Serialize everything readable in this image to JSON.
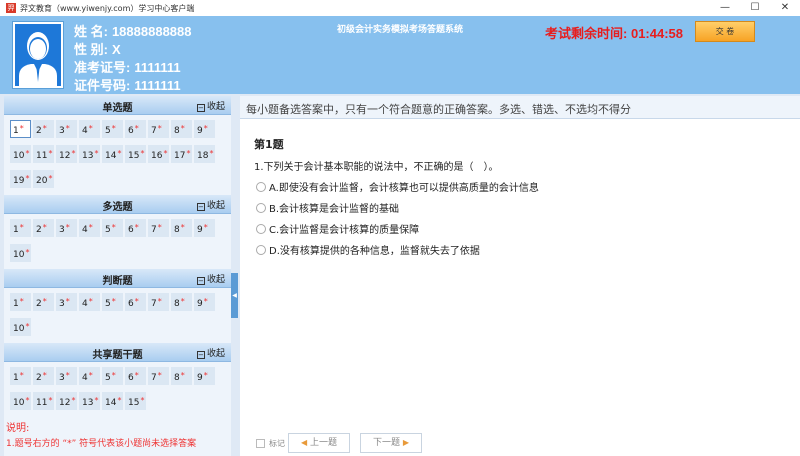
{
  "window": {
    "title": "羿文教育（www.yiwenjy.com）学习中心客户端",
    "logo_text": "羿",
    "controls": {
      "minimize": "—",
      "maximize": "☐",
      "close": "✕"
    }
  },
  "header": {
    "name_label": "姓 名:",
    "name_value": "18888888888",
    "gender_label": "性 别:",
    "gender_value": "X",
    "ticket_label": "准考证号:",
    "ticket_value": "1111111",
    "id_label": "证件号码:",
    "id_value": "1111111",
    "system_title": "初级会计实务模拟考场答题系统",
    "timer_label": "考试剩余时间:",
    "timer_value": "01:44:58",
    "submit_label": "交 卷"
  },
  "sections": [
    {
      "title": "单选题",
      "collapse": "收起",
      "items": [
        "1",
        "2",
        "3",
        "4",
        "5",
        "6",
        "7",
        "8",
        "9",
        "10",
        "11",
        "12",
        "13",
        "14",
        "15",
        "16",
        "17",
        "18",
        "19",
        "20"
      ],
      "active": "1"
    },
    {
      "title": "多选题",
      "collapse": "收起",
      "items": [
        "1",
        "2",
        "3",
        "4",
        "5",
        "6",
        "7",
        "8",
        "9",
        "10"
      ]
    },
    {
      "title": "判断题",
      "collapse": "收起",
      "items": [
        "1",
        "2",
        "3",
        "4",
        "5",
        "6",
        "7",
        "8",
        "9",
        "10"
      ]
    },
    {
      "title": "共享题干题",
      "collapse": "收起",
      "items": [
        "1",
        "2",
        "3",
        "4",
        "5",
        "6",
        "7",
        "8",
        "9",
        "10",
        "11",
        "12",
        "13",
        "14",
        "15"
      ]
    }
  ],
  "unanswered_marker": "*",
  "notes": {
    "title": "说明:",
    "text": "1.题号右方的 “*” 符号代表该小题尚未选择答案"
  },
  "question": {
    "instruction": "每小题备选答案中，只有一个符合题意的正确答案。多选、错选、不选均不得分",
    "number_label": "第1题",
    "stem": "1.下列关于会计基本职能的说法中，不正确的是（　）。",
    "options": [
      "A.即使没有会计监督，会计核算也可以提供高质量的会计信息",
      "B.会计核算是会计监督的基础",
      "C.会计监督是会计核算的质量保障",
      "D.没有核算提供的各种信息，监督就失去了依据"
    ]
  },
  "bottom": {
    "mark_label": "标记",
    "prev_label": "上一题",
    "next_label": "下一题"
  },
  "colors": {
    "header_bg": "#87c0ee",
    "timer": "#e81d1d",
    "accent": "#f7a325"
  }
}
